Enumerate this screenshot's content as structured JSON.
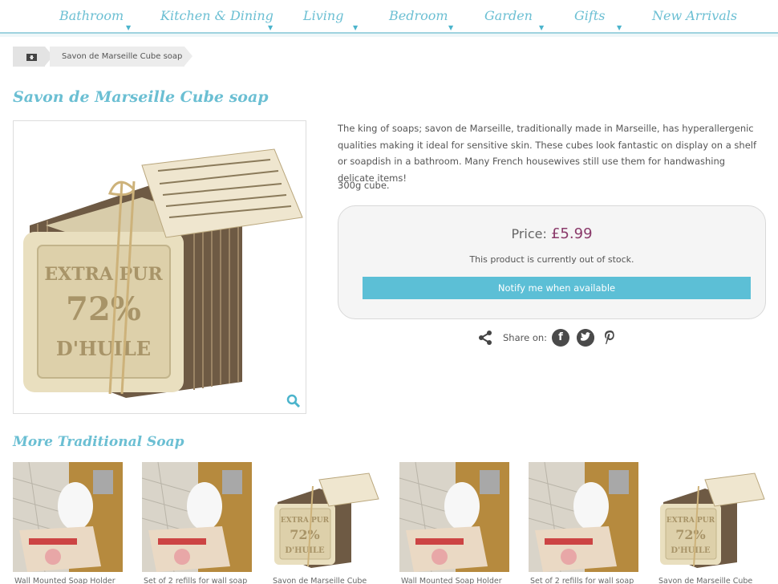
{
  "nav": {
    "items": [
      {
        "label": "Bathroom",
        "has_dropdown": true
      },
      {
        "label": "Kitchen & Dining",
        "has_dropdown": true
      },
      {
        "label": "Living",
        "has_dropdown": true
      },
      {
        "label": "Bedroom",
        "has_dropdown": true
      },
      {
        "label": "Garden",
        "has_dropdown": true
      },
      {
        "label": "Gifts",
        "has_dropdown": true
      },
      {
        "label": "New Arrivals",
        "has_dropdown": false
      }
    ],
    "dropdown_glyph": "▼"
  },
  "breadcrumb": {
    "home_icon": "home-icon",
    "current": "Savon de Marseille Cube soap"
  },
  "product": {
    "title": "Savon de Marseille Cube soap",
    "description": "The king of soaps; savon de Marseille, traditionally made in Marseille, has hyperallergenic qualities making it ideal for sensitive skin. These cubes look fantastic on display on a shelf or soapdish in a bathroom. Many French housewives still use them for handwashing delicate items!",
    "weight": "300g cube.",
    "price_label": "Price:",
    "price_value": "£5.99",
    "stock_text": "This product is currently out of stock.",
    "notify_label": "Notify me when available",
    "soap_text": [
      "EXTRA PUR",
      "72%",
      "D'HUILE"
    ]
  },
  "share": {
    "label": "Share on:",
    "networks": [
      "facebook-icon",
      "twitter-icon",
      "pinterest-icon"
    ]
  },
  "related": {
    "title": "More Traditional Soap",
    "items": [
      {
        "caption": "Wall Mounted Soap Holder",
        "kind": "holder"
      },
      {
        "caption": "Set of 2 refills for wall soap",
        "kind": "holder"
      },
      {
        "caption": "Savon de Marseille Cube",
        "kind": "cube"
      },
      {
        "caption": "Wall Mounted Soap Holder",
        "kind": "holder"
      },
      {
        "caption": "Set of 2 refills for wall soap",
        "kind": "holder"
      },
      {
        "caption": "Savon de Marseille Cube",
        "kind": "cube"
      }
    ]
  },
  "colors": {
    "accent": "#6bbfd3",
    "button": "#5cbfd6",
    "price": "#8a3a6a"
  }
}
